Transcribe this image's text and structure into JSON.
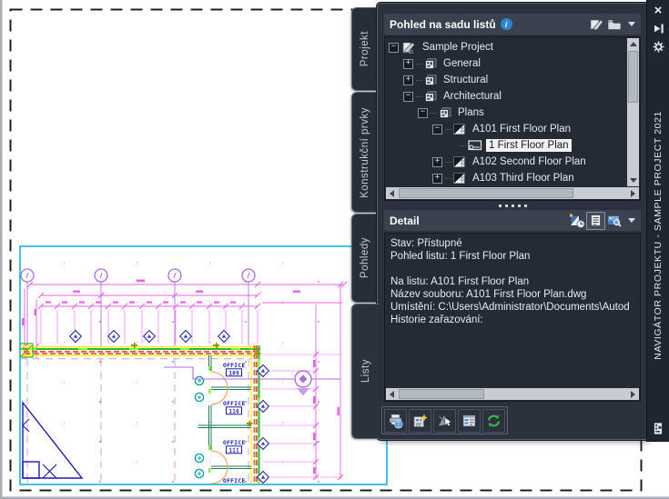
{
  "palette": {
    "titlebar": {
      "title": "NAVIGÁTOR PROJEKTU - SAMPLE PROJECT 2021",
      "close_glyph": "×"
    },
    "tabs": [
      {
        "label": "Projekt"
      },
      {
        "label": "Konstrukční prvky"
      },
      {
        "label": "Pohledy"
      },
      {
        "label": "Listy",
        "active": true
      }
    ],
    "tree_header": {
      "title": "Pohled na sadu listů",
      "info_glyph": "i"
    },
    "tree": {
      "items": [
        {
          "label": "Sample Project",
          "toggle": "−",
          "icon": "project-icon",
          "level": 0
        },
        {
          "label": "General",
          "toggle": "+",
          "icon": "subset-icon",
          "level": 1
        },
        {
          "label": "Structural",
          "toggle": "+",
          "icon": "subset-icon",
          "level": 1
        },
        {
          "label": "Architectural",
          "toggle": "−",
          "icon": "subset-icon",
          "level": 1
        },
        {
          "label": "Plans",
          "toggle": "−",
          "icon": "subset-icon",
          "level": 2
        },
        {
          "label": "A101 First Floor Plan",
          "toggle": "−",
          "icon": "sheet-icon",
          "level": 3
        },
        {
          "label": "1 First Floor Plan",
          "toggle": "",
          "icon": "view-icon",
          "level": 4,
          "selected": true
        },
        {
          "label": "A102 Second Floor Plan",
          "toggle": "+",
          "icon": "sheet-icon",
          "level": 3
        },
        {
          "label": "A103 Third Floor Plan",
          "toggle": "+",
          "icon": "sheet-icon",
          "level": 3
        }
      ]
    },
    "detail_header": {
      "title": "Detail"
    },
    "detail": {
      "lines": [
        "Stav: Přístupné",
        "Pohled listu: 1 First Floor Plan",
        "",
        "Na listu: A101 First Floor Plan",
        "Název souboru: A101 First Floor Plan.dwg",
        "Umístění: C:\\Users\\Administrator\\Documents\\Autod",
        "Historie zařazování:"
      ]
    },
    "icons": {
      "tree_header": [
        "edit-sheet-set-icon",
        "open-folder-icon",
        "chevron-down-icon"
      ],
      "detail_header": [
        "sheet-history-icon",
        "details-text-icon",
        "preview-image-icon",
        "chevron-down-icon"
      ],
      "toolbar": [
        "publish-icon",
        "etransmit-icon",
        "repath-icon",
        "sheet-selections-icon",
        "refresh-icon"
      ],
      "titlebar": [
        "close-icon",
        "auto-hide-pin-icon",
        "properties-gear-icon",
        "palette-window-icon"
      ]
    }
  },
  "drawing": {
    "offices": [
      {
        "name": "OFFICE",
        "number": "109"
      },
      {
        "name": "OFFICE",
        "number": "110"
      },
      {
        "name": "OFFICE",
        "number": "111"
      },
      {
        "name": "OFFICE",
        "number": ""
      }
    ],
    "colors": {
      "viewport_cyan": "#17b3e8",
      "dimension_magenta": "#ee5fe8",
      "grid_violet": "#b169e0",
      "plan_navy": "#1b1bb0",
      "wall_orange": "#df5f35",
      "wall_green": "#2eb82e",
      "wall_yellow": "#f2f20a",
      "fixture_teal": "#12a0a0",
      "door_peach": "#f2a96e",
      "refresh_green": "#3fae49",
      "info_blue": "#2f83d3"
    }
  }
}
